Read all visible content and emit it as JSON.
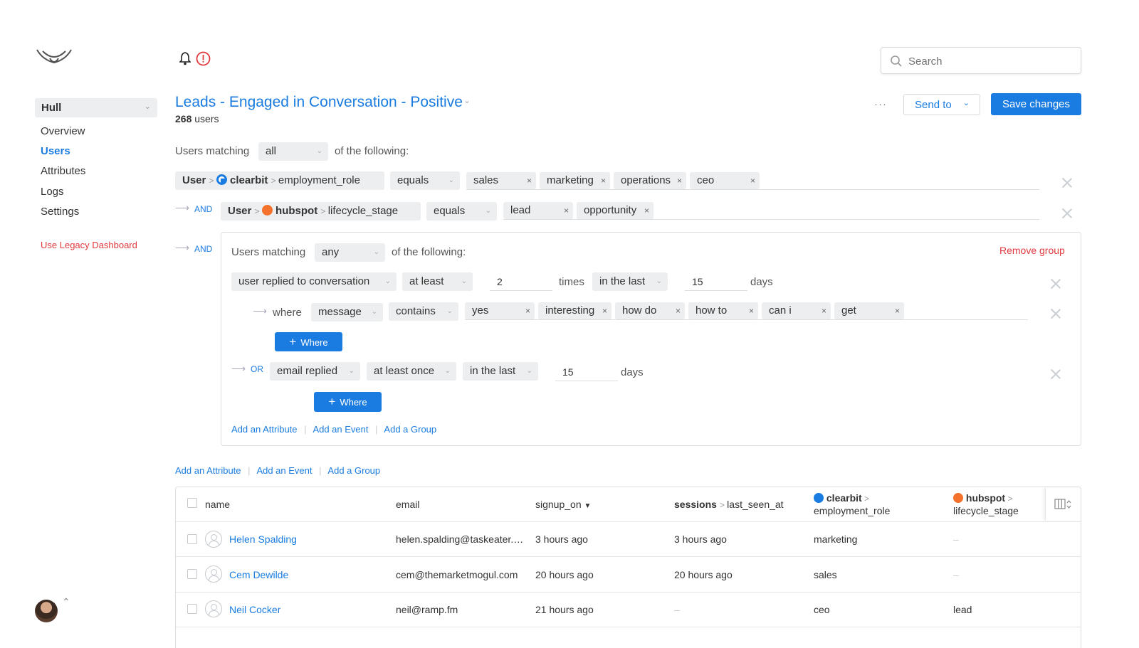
{
  "header": {
    "search_placeholder": "Search"
  },
  "sidebar": {
    "org_selector": "Hull",
    "items": [
      {
        "label": "Overview"
      },
      {
        "label": "Users"
      },
      {
        "label": "Attributes"
      },
      {
        "label": "Logs"
      },
      {
        "label": "Settings"
      }
    ],
    "legacy_link": "Use Legacy Dashboard"
  },
  "segment": {
    "title": "Leads - Engaged in Conversation - Positive",
    "count": "268",
    "count_unit": "users",
    "more_label": "···",
    "send_to_label": "Send to",
    "save_label": "Save changes"
  },
  "filter": {
    "users_matching": "Users matching",
    "match_mode": "all",
    "of_following": "of the following:",
    "and_label": "AND",
    "rule1": {
      "entity": "User",
      "source": "clearbit",
      "attribute": "employment_role",
      "operator": "equals",
      "values": [
        "sales",
        "marketing",
        "operations",
        "ceo"
      ]
    },
    "rule2": {
      "entity": "User",
      "source": "hubspot",
      "attribute": "lifecycle_stage",
      "operator": "equals",
      "values": [
        "lead",
        "opportunity"
      ]
    },
    "group": {
      "users_matching": "Users matching",
      "match_mode": "any",
      "of_following": "of the following:",
      "remove_label": "Remove group",
      "event1": {
        "event": "user replied to conversation",
        "frequency": "at least",
        "count": "2",
        "times_label": "times",
        "window": "in the last",
        "window_value": "15",
        "days_label": "days",
        "where_label": "where",
        "where_field": "message",
        "where_operator": "contains",
        "where_values": [
          "yes",
          "interesting",
          "how do",
          "how to",
          "can i",
          "get"
        ],
        "where_button": "Where"
      },
      "or_label": "OR",
      "event2": {
        "event": "email replied",
        "frequency": "at least once",
        "window": "in the last",
        "window_value": "15",
        "days_label": "days",
        "where_button": "Where"
      },
      "links": [
        "Add an Attribute",
        "Add an Event",
        "Add a Group"
      ]
    },
    "links": [
      "Add an Attribute",
      "Add an Event",
      "Add a Group"
    ]
  },
  "table": {
    "columns": {
      "name": "name",
      "email": "email",
      "signup": "signup_on",
      "sessions": "sessions",
      "last_seen": "last_seen_at",
      "clearbit_src": "clearbit",
      "clearbit_attr": "employment_role",
      "hubspot_src": "hubspot",
      "hubspot_attr": "lifecycle_stage"
    },
    "rows": [
      {
        "name": "Helen Spalding",
        "email": "helen.spalding@taskeater.…",
        "signup": "3 hours ago",
        "last_seen": "3 hours ago",
        "role": "marketing",
        "stage": "–"
      },
      {
        "name": "Cem Dewilde",
        "email": "cem@themarketmogul.com",
        "signup": "20 hours ago",
        "last_seen": "20 hours ago",
        "role": "sales",
        "stage": "–"
      },
      {
        "name": "Neil Cocker",
        "email": "neil@ramp.fm",
        "signup": "21 hours ago",
        "last_seen": "–",
        "role": "ceo",
        "stage": "lead"
      }
    ]
  },
  "colors": {
    "accent": "#1a7ce0",
    "danger": "#e0393e",
    "chip_bg": "#eceeef",
    "hubspot": "#f5722c"
  }
}
